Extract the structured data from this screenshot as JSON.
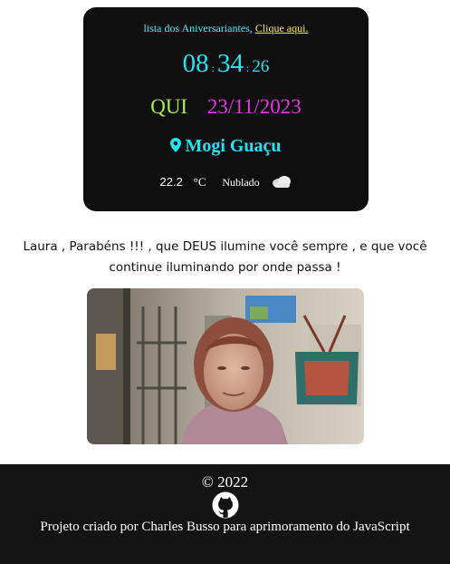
{
  "clock_card": {
    "birthday_text": "lista dos Aniversariantes,",
    "birthday_link": "Clique aqui.",
    "hours": "08",
    "separator1": ":",
    "minutes": "34",
    "separator2": ":",
    "seconds": "26",
    "weekday": "QUI",
    "date": "23/11/2023",
    "city": "Mogi Guaçu",
    "city_icon": "location-pin-icon",
    "temperature": "22.2",
    "unit": "°C",
    "condition": "Nublado",
    "condition_icon": "cloud-icon"
  },
  "message": {
    "line1": "Laura , Parabéns !!! , que DEUS ilumine você sempre , e que você",
    "line2": "continue iluminando por onde passa !"
  },
  "footer": {
    "copyright": "© 2022",
    "github_icon": "github-icon",
    "credit": "Projeto criado por Charles Busso para aprimoramento do JavaScript"
  },
  "colors": {
    "card_bg": "#0f0f0f",
    "cyan": "#23e4f5",
    "green": "#a6f04a",
    "magenta": "#e633e6",
    "yellow_link": "#ffe94a",
    "footer_bg": "#141414"
  }
}
